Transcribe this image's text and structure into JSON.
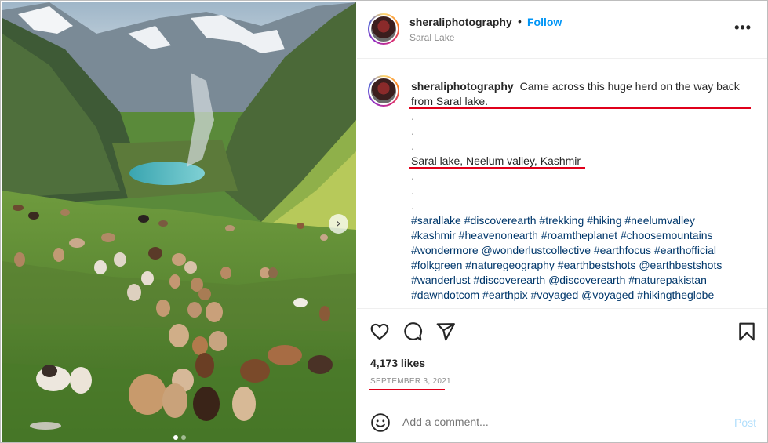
{
  "post": {
    "username": "sheraliphotography",
    "separator": "•",
    "follow_label": "Follow",
    "location": "Saral Lake",
    "more_label": "•••"
  },
  "caption": {
    "username": "sheraliphotography",
    "text": "Came across this huge herd on the way back from Saral lake.",
    "dot": ".",
    "place": "Saral lake, Neelum valley, Kashmir",
    "hashtags_lines": [
      "#sarallake #discoverearth #trekking #hiking #neelumvalley",
      "#kashmir #heavenonearth #roamtheplanet #choosemountains",
      "#wondermore @wonderlustcollective #earthfocus #earthofficial",
      "#folkgreen #naturegeography #earthbestshots @earthbestshots",
      "#wanderlust #discoverearth @discoverearth #naturepakistan",
      "#dawndotcom #earthpix #voyaged @voyaged #hikingtheglobe"
    ]
  },
  "actions": {
    "like_icon": "heart-icon",
    "comment_icon": "comment-icon",
    "share_icon": "share-icon",
    "save_icon": "bookmark-icon"
  },
  "likes": "4,173 likes",
  "date": "SEPTEMBER 3, 2021",
  "comment": {
    "placeholder": "Add a comment...",
    "post_label": "Post",
    "emoji_icon": "smiley-icon"
  },
  "carousel": {
    "next_symbol": "›",
    "slide_count": 2,
    "active_slide": 1
  },
  "colors": {
    "link_blue": "#0095f6",
    "hashtag": "#00376b",
    "annotation_red": "#e0001b",
    "muted": "#8e8e8e"
  }
}
